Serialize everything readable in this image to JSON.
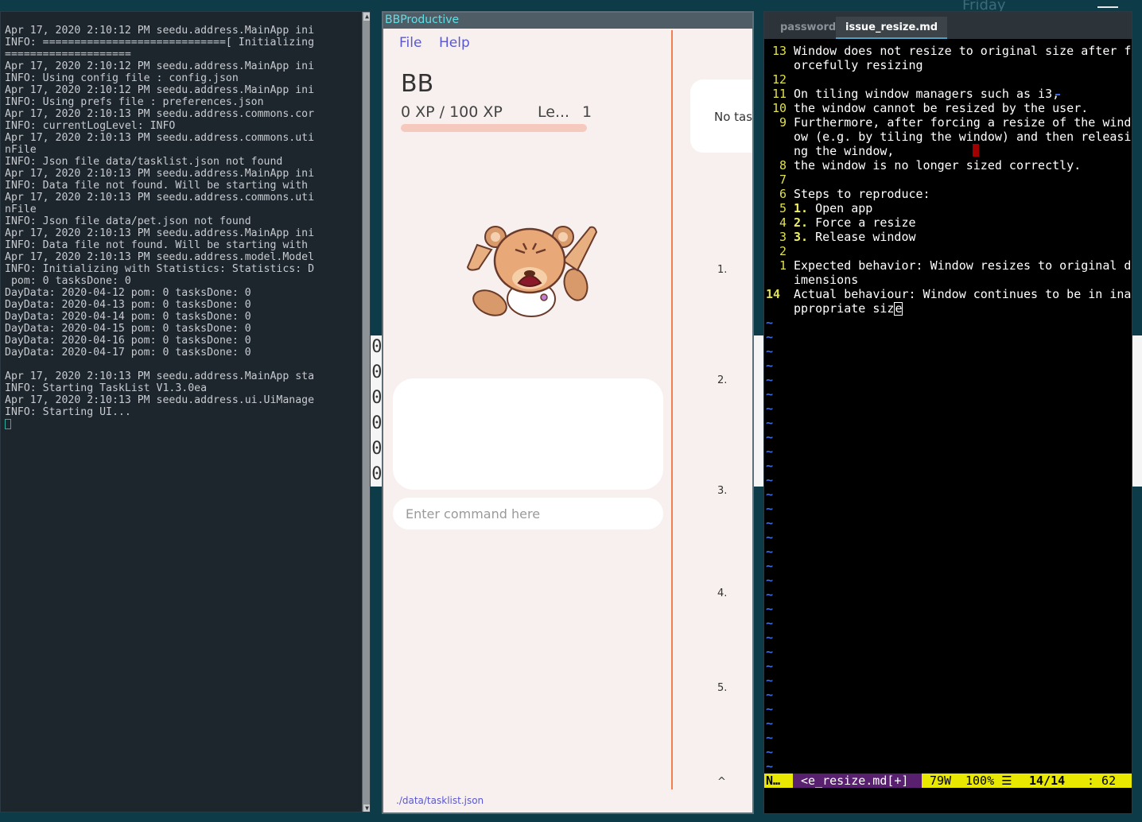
{
  "topbar": {
    "day": "Friday"
  },
  "terminal": {
    "lines": [
      "Apr 17, 2020 2:10:12 PM seedu.address.MainApp ini",
      "INFO: =============================[ Initializing",
      "====================",
      "Apr 17, 2020 2:10:12 PM seedu.address.MainApp ini",
      "INFO: Using config file : config.json",
      "Apr 17, 2020 2:10:12 PM seedu.address.MainApp ini",
      "INFO: Using prefs file : preferences.json",
      "Apr 17, 2020 2:10:13 PM seedu.address.commons.cor",
      "INFO: currentLogLevel: INFO",
      "Apr 17, 2020 2:10:13 PM seedu.address.commons.uti",
      "nFile",
      "INFO: Json file data/tasklist.json not found",
      "Apr 17, 2020 2:10:13 PM seedu.address.MainApp ini",
      "INFO: Data file not found. Will be starting with",
      "Apr 17, 2020 2:10:13 PM seedu.address.commons.uti",
      "nFile",
      "INFO: Json file data/pet.json not found",
      "Apr 17, 2020 2:10:13 PM seedu.address.MainApp ini",
      "INFO: Data file not found. Will be starting with",
      "Apr 17, 2020 2:10:13 PM seedu.address.model.Model",
      "INFO: Initializing with Statistics: Statistics: D",
      " pom: 0 tasksDone: 0",
      "DayData: 2020-04-12 pom: 0 tasksDone: 0",
      "DayData: 2020-04-13 pom: 0 tasksDone: 0",
      "DayData: 2020-04-14 pom: 0 tasksDone: 0",
      "DayData: 2020-04-15 pom: 0 tasksDone: 0",
      "DayData: 2020-04-16 pom: 0 tasksDone: 0",
      "DayData: 2020-04-17 pom: 0 tasksDone: 0",
      "",
      "Apr 17, 2020 2:10:13 PM seedu.address.MainApp sta",
      "INFO: Starting TaskList V1.3.0ea",
      "Apr 17, 2020 2:10:13 PM seedu.address.ui.UiManage",
      "INFO: Starting UI..."
    ]
  },
  "background_window": {
    "rows": [
      "00",
      "00",
      "00",
      "00",
      "00",
      "00"
    ]
  },
  "bbp": {
    "title": "BBProductive",
    "menu": {
      "file": "File",
      "help": "Help"
    },
    "pet_name": "BB",
    "xp_text": "0 XP / 100 XP",
    "xp_progress": 0,
    "level_label": "Le...",
    "level_value": "1",
    "command_placeholder": "Enter command here",
    "no_tasks_text": "No tas",
    "task_numbers": [
      "1.",
      "2.",
      "3.",
      "4.",
      "5.",
      "^"
    ],
    "status_path": "./data/tasklist.json"
  },
  "vim": {
    "tabs": {
      "password": "password",
      "issue": "issue_resize.md"
    },
    "lines": [
      {
        "num": "13",
        "text": "Window does not resize to original size after f"
      },
      {
        "num": "",
        "text": "orcefully resizing"
      },
      {
        "num": "12",
        "text": ""
      },
      {
        "num": "11",
        "text": "On tiling window managers such as i3,"
      },
      {
        "num": "10",
        "text": "the window cannot be resized by the user."
      },
      {
        "num": "9",
        "text": "Furthermore, after forcing a resize of the wind"
      },
      {
        "num": "",
        "text": "ow (e.g. by tiling the window) and then releasi"
      },
      {
        "num": "",
        "text": "ng the window,"
      },
      {
        "num": "8",
        "text": "the window is no longer sized correctly."
      },
      {
        "num": "7",
        "text": ""
      },
      {
        "num": "6",
        "text": "Steps to reproduce:"
      },
      {
        "num": "5",
        "mark": "1.",
        "text": " Open app"
      },
      {
        "num": "4",
        "mark": "2.",
        "text": " Force a resize"
      },
      {
        "num": "3",
        "mark": "3.",
        "text": " Release window"
      },
      {
        "num": "2",
        "text": ""
      },
      {
        "num": "1",
        "text": "Expected behavior: Window resizes to original d"
      },
      {
        "num": "",
        "text": "imensions"
      },
      {
        "num": "14",
        "text": "Actual behaviour: Window continues to be in ina",
        "current": true
      },
      {
        "num": "",
        "text": "ppropriate siz",
        "cursor": "e"
      }
    ],
    "tilde": "~",
    "statusline": {
      "mode": "N…",
      "file": "<e_resize.md[+]",
      "words": "79W",
      "percent": "100% ☰",
      "position": "14/14  ",
      "column": ": 62"
    }
  }
}
